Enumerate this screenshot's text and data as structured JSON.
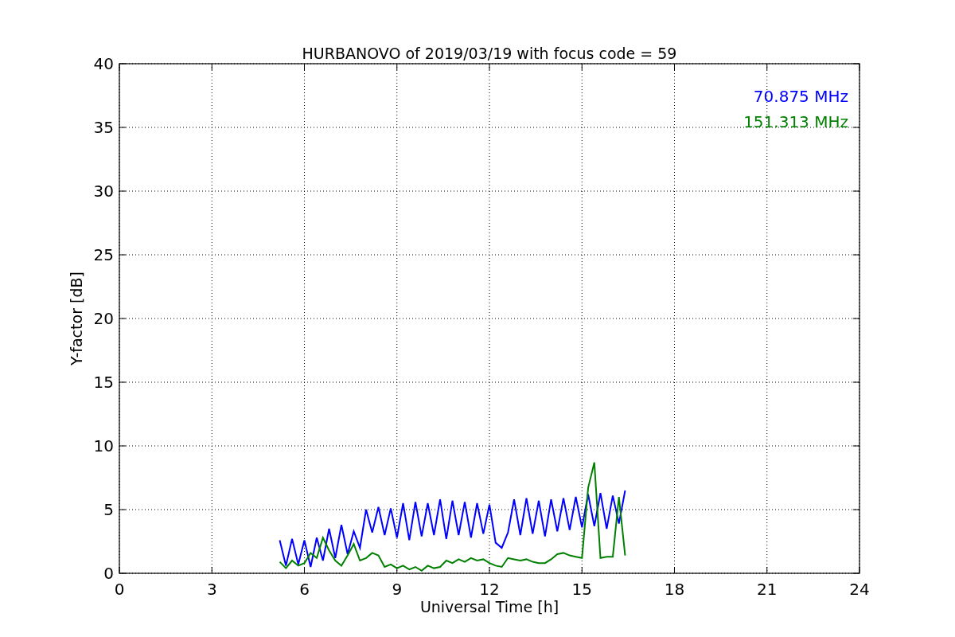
{
  "chart_data": {
    "type": "line",
    "title": "HURBANOVO of 2019/03/19 with focus code = 59",
    "xlabel": "Universal Time [h]",
    "ylabel": "Y-factor [dB]",
    "x": [
      5.2,
      5.4,
      5.6,
      5.8,
      6.0,
      6.2,
      6.4,
      6.6,
      6.8,
      7.0,
      7.2,
      7.4,
      7.6,
      7.8,
      8.0,
      8.2,
      8.4,
      8.6,
      8.8,
      9.0,
      9.2,
      9.4,
      9.6,
      9.8,
      10.0,
      10.2,
      10.4,
      10.6,
      10.8,
      11.0,
      11.2,
      11.4,
      11.6,
      11.8,
      12.0,
      12.2,
      12.4,
      12.6,
      12.8,
      13.0,
      13.2,
      13.4,
      13.6,
      13.8,
      14.0,
      14.2,
      14.4,
      14.6,
      14.8,
      15.0,
      15.2,
      15.4,
      15.6,
      15.8,
      16.0,
      16.2,
      16.4
    ],
    "series": [
      {
        "name": "70.875 MHz",
        "color": "#0000ff",
        "values": [
          2.6,
          0.6,
          2.7,
          0.7,
          2.6,
          0.5,
          2.8,
          1.0,
          3.5,
          1.2,
          3.8,
          1.5,
          3.3,
          2.0,
          5.0,
          3.2,
          5.2,
          3.0,
          5.1,
          2.8,
          5.5,
          2.6,
          5.6,
          2.9,
          5.5,
          3.0,
          5.8,
          2.7,
          5.7,
          3.0,
          5.6,
          2.8,
          5.5,
          3.1,
          5.4,
          2.4,
          2.0,
          3.2,
          5.8,
          3.0,
          5.9,
          3.1,
          5.7,
          2.9,
          5.8,
          3.3,
          5.9,
          3.4,
          6.0,
          3.6,
          6.2,
          3.7,
          6.3,
          3.5,
          6.1,
          3.9,
          6.5
        ]
      },
      {
        "name": "151.313 MHz",
        "color": "#008000",
        "values": [
          0.9,
          0.4,
          1.0,
          0.6,
          0.8,
          1.6,
          1.2,
          2.8,
          1.8,
          1.0,
          0.6,
          1.4,
          2.3,
          1.0,
          1.2,
          1.6,
          1.4,
          0.5,
          0.7,
          0.4,
          0.6,
          0.3,
          0.5,
          0.2,
          0.6,
          0.4,
          0.5,
          1.0,
          0.8,
          1.1,
          0.9,
          1.2,
          1.0,
          1.1,
          0.8,
          0.6,
          0.5,
          1.2,
          1.1,
          1.0,
          1.1,
          0.9,
          0.8,
          0.8,
          1.1,
          1.5,
          1.6,
          1.4,
          1.3,
          1.2,
          6.7,
          8.7,
          1.2,
          1.3,
          1.3,
          6.0,
          1.4
        ]
      }
    ],
    "xlim": [
      0,
      24
    ],
    "ylim": [
      0,
      40
    ],
    "grid": true,
    "xticks": [
      0,
      3,
      6,
      9,
      12,
      15,
      18,
      21,
      24
    ],
    "yticks": [
      0,
      5,
      10,
      15,
      20,
      25,
      30,
      35,
      40
    ]
  }
}
